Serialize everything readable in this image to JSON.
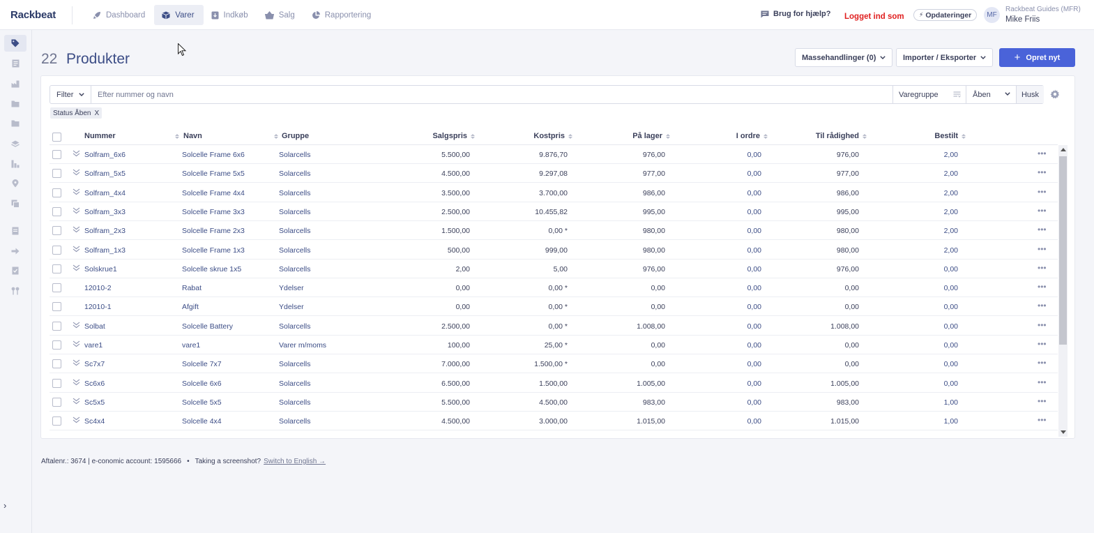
{
  "app": {
    "logo": "Rackbeat",
    "nav": [
      {
        "label": "Dashboard",
        "icon": "rocket-icon",
        "active": false
      },
      {
        "label": "Varer",
        "icon": "box-icon",
        "active": true
      },
      {
        "label": "Indkøb",
        "icon": "purchase-icon",
        "active": false
      },
      {
        "label": "Salg",
        "icon": "basket-icon",
        "active": false
      },
      {
        "label": "Rapportering",
        "icon": "pie-chart-icon",
        "active": false
      }
    ],
    "help": "Brug for hjælp?",
    "logged_in": "Logget ind som",
    "updates": "Opdateringer",
    "user": {
      "initials": "MF",
      "company": "Rackbeat Guides (MFR)",
      "name": "Mike Friis"
    }
  },
  "sidebar": {
    "icons": [
      "tag-icon",
      "document-icon",
      "factory-icon",
      "folder-icon",
      "folder-icon",
      "layers-icon",
      "chart-bar-icon",
      "location-pin-icon",
      "copy-icon",
      "ledger-icon",
      "arrow-right-icon",
      "checklist-icon",
      "route-icon"
    ],
    "expand": "›"
  },
  "page": {
    "count": "22",
    "title": "Produkter",
    "mass_actions": "Massehandlinger (0)",
    "import_export": "Importer / Eksporter",
    "create": "Opret nyt"
  },
  "filters": {
    "filter_label": "Filter",
    "search_placeholder": "Efter nummer og navn",
    "group_placeholder": "Varegruppe",
    "status": "Åben",
    "remember": "Husk",
    "active_tag": "Status Åben",
    "tag_remove": "X"
  },
  "table": {
    "columns": {
      "number": "Nummer",
      "name": "Navn",
      "group": "Gruppe",
      "sales_price": "Salgspris",
      "cost_price": "Kostpris",
      "in_stock": "På lager",
      "in_order": "I ordre",
      "available": "Til rådighed",
      "ordered": "Bestilt"
    },
    "rows": [
      {
        "number": "Solfram_6x6",
        "name": "Solcelle Frame 6x6",
        "group": "Solarcells",
        "sales": "5.500,00",
        "cost": "9.876,70",
        "stock": "976,00",
        "in_order": "0,00",
        "available": "976,00",
        "ordered": "2,00",
        "expandable": true
      },
      {
        "number": "Solfram_5x5",
        "name": "Solcelle Frame 5x5",
        "group": "Solarcells",
        "sales": "4.500,00",
        "cost": "9.297,08",
        "stock": "977,00",
        "in_order": "0,00",
        "available": "977,00",
        "ordered": "2,00",
        "expandable": true
      },
      {
        "number": "Solfram_4x4",
        "name": "Solcelle Frame 4x4",
        "group": "Solarcells",
        "sales": "3.500,00",
        "cost": "3.700,00",
        "stock": "986,00",
        "in_order": "0,00",
        "available": "986,00",
        "ordered": "2,00",
        "expandable": true
      },
      {
        "number": "Solfram_3x3",
        "name": "Solcelle Frame 3x3",
        "group": "Solarcells",
        "sales": "2.500,00",
        "cost": "10.455,82",
        "stock": "995,00",
        "in_order": "0,00",
        "available": "995,00",
        "ordered": "2,00",
        "expandable": true
      },
      {
        "number": "Solfram_2x3",
        "name": "Solcelle Frame 2x3",
        "group": "Solarcells",
        "sales": "1.500,00",
        "cost": "0,00 *",
        "stock": "980,00",
        "in_order": "0,00",
        "available": "980,00",
        "ordered": "2,00",
        "expandable": true
      },
      {
        "number": "Solfram_1x3",
        "name": "Solcelle Frame 1x3",
        "group": "Solarcells",
        "sales": "500,00",
        "cost": "999,00",
        "stock": "980,00",
        "in_order": "0,00",
        "available": "980,00",
        "ordered": "2,00",
        "expandable": true
      },
      {
        "number": "Solskrue1",
        "name": "Solcelle skrue 1x5",
        "group": "Solarcells",
        "sales": "2,00",
        "cost": "5,00",
        "stock": "976,00",
        "in_order": "0,00",
        "available": "976,00",
        "ordered": "0,00",
        "expandable": true
      },
      {
        "number": "12010-2",
        "name": "Rabat",
        "group": "Ydelser",
        "sales": "0,00",
        "cost": "0,00 *",
        "stock": "0,00",
        "in_order": "0,00",
        "available": "0,00",
        "ordered": "0,00",
        "expandable": false
      },
      {
        "number": "12010-1",
        "name": "Afgift",
        "group": "Ydelser",
        "sales": "0,00",
        "cost": "0,00 *",
        "stock": "0,00",
        "in_order": "0,00",
        "available": "0,00",
        "ordered": "0,00",
        "expandable": false
      },
      {
        "number": "Solbat",
        "name": "Solcelle Battery",
        "group": "Solarcells",
        "sales": "2.500,00",
        "cost": "0,00 *",
        "stock": "1.008,00",
        "in_order": "0,00",
        "available": "1.008,00",
        "ordered": "0,00",
        "expandable": true
      },
      {
        "number": "vare1",
        "name": "vare1",
        "group": "Varer m/moms",
        "sales": "100,00",
        "cost": "25,00 *",
        "stock": "0,00",
        "in_order": "0,00",
        "available": "0,00",
        "ordered": "0,00",
        "expandable": true
      },
      {
        "number": "Sc7x7",
        "name": "Solcelle 7x7",
        "group": "Solarcells",
        "sales": "7.000,00",
        "cost": "1.500,00 *",
        "stock": "0,00",
        "in_order": "0,00",
        "available": "0,00",
        "ordered": "0,00",
        "expandable": true
      },
      {
        "number": "Sc6x6",
        "name": "Solcelle 6x6",
        "group": "Solarcells",
        "sales": "6.500,00",
        "cost": "1.500,00",
        "stock": "1.005,00",
        "in_order": "0,00",
        "available": "1.005,00",
        "ordered": "0,00",
        "expandable": true
      },
      {
        "number": "Sc5x5",
        "name": "Solcelle 5x5",
        "group": "Solarcells",
        "sales": "5.500,00",
        "cost": "4.500,00",
        "stock": "983,00",
        "in_order": "0,00",
        "available": "983,00",
        "ordered": "1,00",
        "expandable": true
      },
      {
        "number": "Sc4x4",
        "name": "Solcelle 4x4",
        "group": "Solarcells",
        "sales": "4.500,00",
        "cost": "3.000,00",
        "stock": "1.015,00",
        "in_order": "0,00",
        "available": "1.015,00",
        "ordered": "1,00",
        "expandable": true
      }
    ],
    "row_menu": "•••"
  },
  "footer": {
    "account": "Aftalenr.: 3674 | e-conomic account: 1595666",
    "separator": "•",
    "screenshot": "Taking a screenshot?",
    "switch": "Switch to English →"
  }
}
